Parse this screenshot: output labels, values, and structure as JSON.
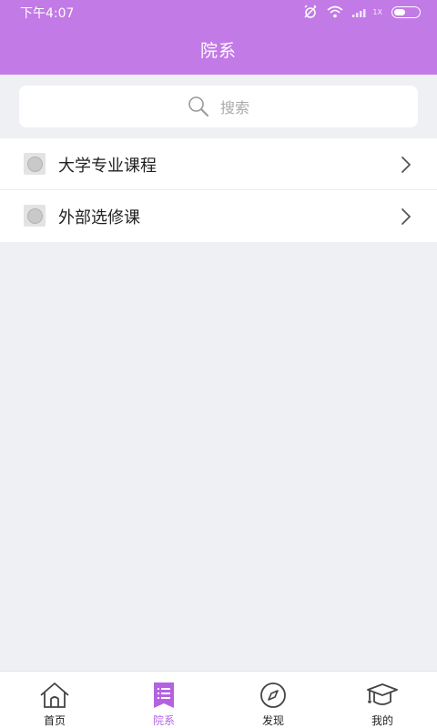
{
  "status_bar": {
    "time": "下午4:07",
    "sim_label": "1X"
  },
  "header": {
    "title": "院系"
  },
  "search": {
    "placeholder": "搜索"
  },
  "list": {
    "items": [
      {
        "label": "大学专业课程"
      },
      {
        "label": "外部选修课"
      }
    ]
  },
  "tabbar": {
    "tabs": [
      {
        "label": "首页",
        "icon": "home-icon"
      },
      {
        "label": "院系",
        "icon": "list-bookmark-icon"
      },
      {
        "label": "发现",
        "icon": "compass-icon"
      },
      {
        "label": "我的",
        "icon": "graduation-cap-icon"
      }
    ],
    "active_index": 1
  },
  "colors": {
    "brand": "#c27ae6",
    "active_tab": "#b463e0",
    "background": "#eff0f4"
  }
}
